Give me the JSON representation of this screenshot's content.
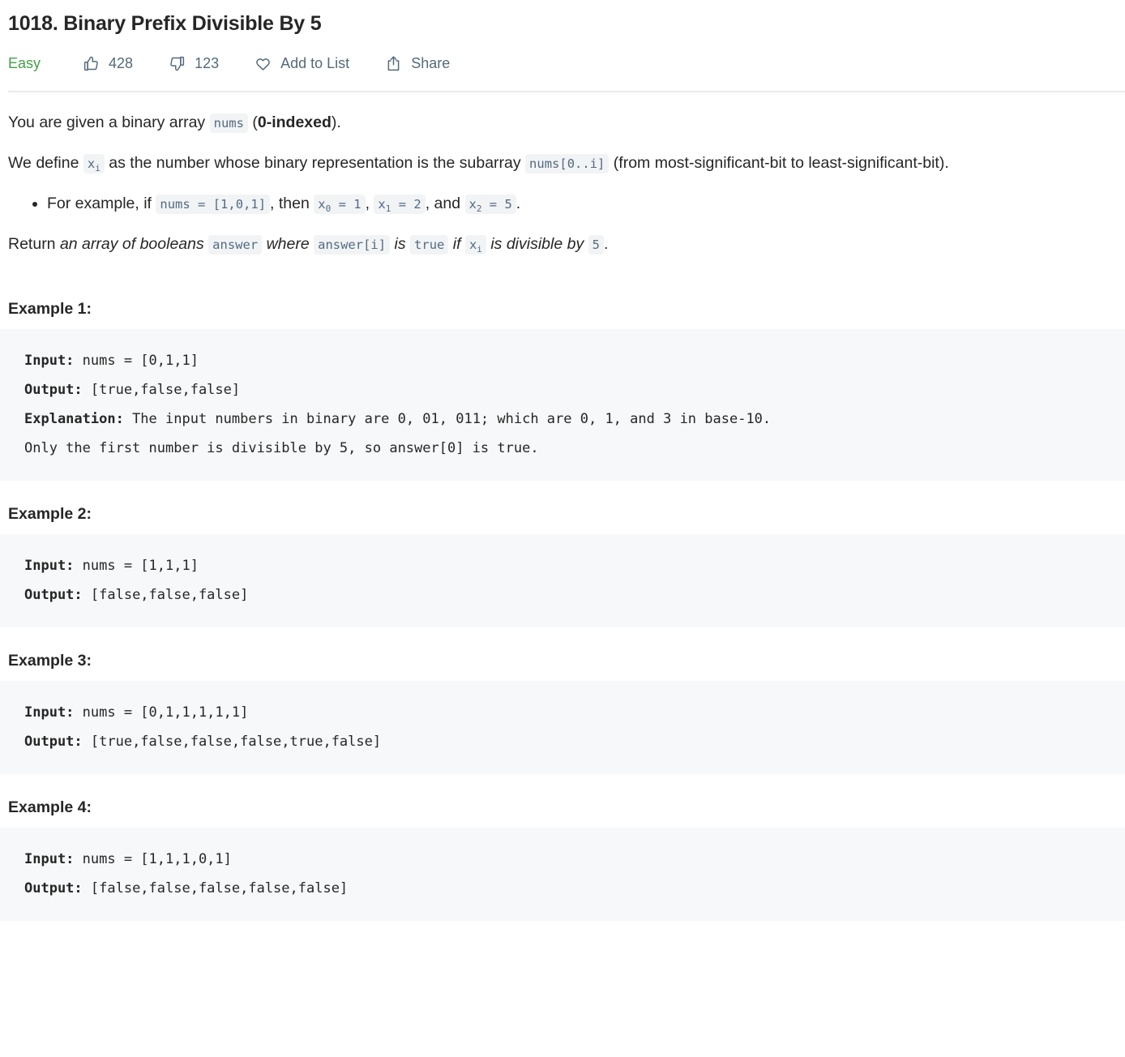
{
  "problem": {
    "title": "1018. Binary Prefix Divisible By 5",
    "difficulty": "Easy",
    "difficulty_color": "#43a047"
  },
  "actions": {
    "likes": "428",
    "dislikes": "123",
    "add_to_list": "Add to List",
    "share": "Share"
  },
  "description": {
    "p1": {
      "t1": "You are given a binary array ",
      "c1": "nums",
      "t2": " (",
      "b1": "0-indexed",
      "t3": ")."
    },
    "p2": {
      "t1": "We define ",
      "c1": "x",
      "c1sub": "i",
      "t2": " as the number whose binary representation is the subarray ",
      "c2": "nums[0..i]",
      "t3": " (from most-significant-bit to least-significant-bit)."
    },
    "bullet1": {
      "t1": "For example, if ",
      "c1": "nums = [1,0,1]",
      "t2": ", then ",
      "c2": "x",
      "c2sub": "0",
      "c2rest": " = 1",
      "t3": ", ",
      "c3": "x",
      "c3sub": "1",
      "c3rest": " = 2",
      "t4": ", and ",
      "c4": "x",
      "c4sub": "2",
      "c4rest": " = 5",
      "t5": "."
    },
    "p3": {
      "t1": "Return ",
      "i1": "an array of booleans ",
      "c1": "answer",
      "i2": " where ",
      "c2": "answer[i]",
      "i3": " is ",
      "c3": "true",
      "i4": " if ",
      "c4": "x",
      "c4sub": "i",
      "i5": " is divisible by ",
      "c5": "5",
      "t2": "."
    }
  },
  "examples": [
    {
      "heading": "Example 1:",
      "input_label": "Input:",
      "input_value": " nums = [0,1,1]",
      "output_label": "Output:",
      "output_value": " [true,false,false]",
      "explanation_label": "Explanation:",
      "explanation_value": " The input numbers in binary are 0, 01, 011; which are 0, 1, and 3 in base-10.\nOnly the first number is divisible by 5, so answer[0] is true."
    },
    {
      "heading": "Example 2:",
      "input_label": "Input:",
      "input_value": " nums = [1,1,1]",
      "output_label": "Output:",
      "output_value": " [false,false,false]",
      "explanation_label": "",
      "explanation_value": ""
    },
    {
      "heading": "Example 3:",
      "input_label": "Input:",
      "input_value": " nums = [0,1,1,1,1,1]",
      "output_label": "Output:",
      "output_value": " [true,false,false,false,true,false]",
      "explanation_label": "",
      "explanation_value": ""
    },
    {
      "heading": "Example 4:",
      "input_label": "Input:",
      "input_value": " nums = [1,1,1,0,1]",
      "output_label": "Output:",
      "output_value": " [false,false,false,false,false]",
      "explanation_label": "",
      "explanation_value": ""
    }
  ]
}
